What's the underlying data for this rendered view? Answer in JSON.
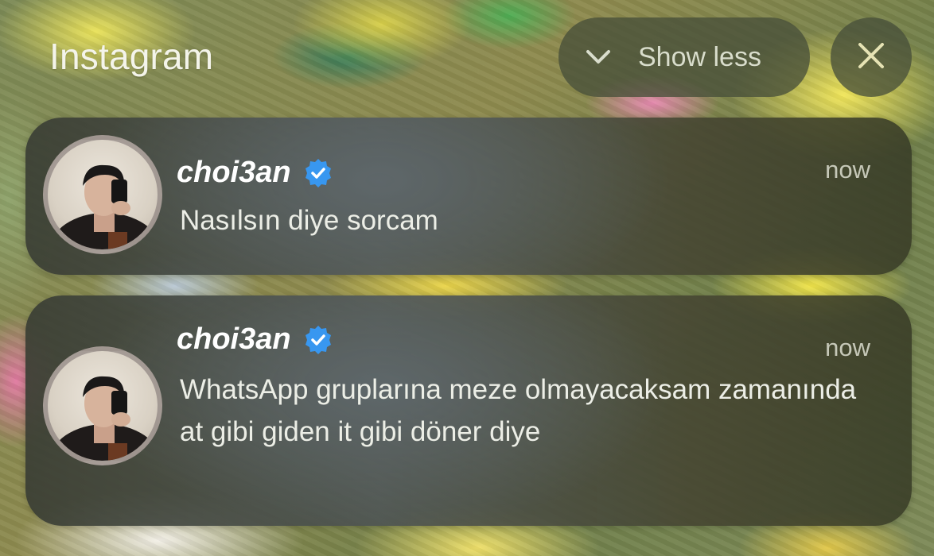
{
  "header": {
    "app_name": "Instagram",
    "show_less_label": "Show less",
    "show_less_icon": "chevron-down-icon",
    "close_icon": "close-icon"
  },
  "notifications": [
    {
      "sender": "choi3an",
      "verified": true,
      "time": "now",
      "message": "Nasılsın diye sorcam"
    },
    {
      "sender": "choi3an",
      "verified": true,
      "time": "now",
      "message": "WhatsApp gruplarına meze olmayacaksam zamanında at gibi giden it gibi döner diye"
    }
  ],
  "colors": {
    "verified_badge": "#3897f0",
    "text_primary": "#ffffff",
    "text_secondary": "#c6c8b8"
  }
}
